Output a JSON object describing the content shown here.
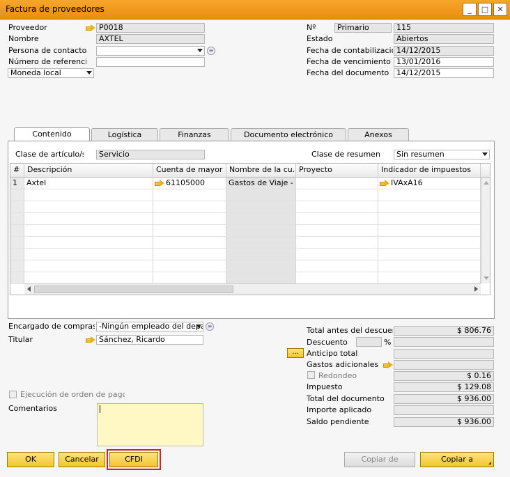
{
  "window": {
    "title": "Factura de proveedores",
    "min": "_",
    "max": "□",
    "close": "✕"
  },
  "header_left": {
    "proveedor_label": "Proveedor",
    "proveedor_value": "P0018",
    "nombre_label": "Nombre",
    "nombre_value": "AXTEL",
    "contacto_label": "Persona de contacto",
    "contacto_value": "",
    "referencia_label": "Número de referencia d",
    "referencia_value": "",
    "moneda_value": "Moneda local"
  },
  "header_right": {
    "no_label": "Nº",
    "serie_value": "Primario",
    "no_value": "115",
    "estado_label": "Estado",
    "estado_value": "Abiertos",
    "fecha_cont_label": "Fecha de contabilización",
    "fecha_cont_value": "14/12/2015",
    "fecha_venc_label": "Fecha de vencimiento",
    "fecha_venc_value": "13/01/2016",
    "fecha_doc_label": "Fecha del documento",
    "fecha_doc_value": "14/12/2015"
  },
  "tabs": [
    "Contenido",
    "Logística",
    "Finanzas",
    "Documento electrónico",
    "Anexos"
  ],
  "content": {
    "clase_articulo_label": "Clase de artículo/ser",
    "clase_articulo_value": "Servicio",
    "clase_resumen_label": "Clase de resumen",
    "clase_resumen_value": "Sin resumen"
  },
  "grid": {
    "headers": [
      "#",
      "Descripción",
      "Cuenta de mayor",
      "Nombre de la cu...",
      "Proyecto",
      "Indicador de impuestos"
    ],
    "rows": [
      {
        "num": "1",
        "descripcion": "Axtel",
        "cuenta": "61105000",
        "nombre": "Gastos de Viaje - Otr",
        "proyecto": "",
        "impuesto": "IVAxA16"
      }
    ]
  },
  "footer_left": {
    "encargado_label": "Encargado de compras",
    "encargado_value": "-Ningún empleado del departa",
    "titular_label": "Titular",
    "titular_value": "Sánchez, Ricardo",
    "ejecucion_label": "Ejecución de orden de pago",
    "comentarios_label": "Comentarios",
    "comentarios_value": ""
  },
  "totals": {
    "total_antes_label": "Total antes del descuento",
    "total_antes_value": "$ 806.76",
    "descuento_label": "Descuento",
    "descuento_pct_symbol": "%",
    "anticipo_btn": "...",
    "anticipo_label": "Anticipo total",
    "gastos_label": "Gastos adicionales",
    "redondeo_label": "Redondeo",
    "redondeo_value": "$ 0.16",
    "impuesto_label": "Impuesto",
    "impuesto_value": "$ 129.08",
    "total_doc_label": "Total del documento",
    "total_doc_value": "$ 936.00",
    "importe_label": "Importe aplicado",
    "importe_value": "",
    "saldo_label": "Saldo pendiente",
    "saldo_value": "$ 936.00"
  },
  "buttons": {
    "ok": "OK",
    "cancel": "Cancelar",
    "cfdi": "CFDI",
    "copy_from": "Copiar de",
    "copy_to": "Copiar a"
  },
  "colors": {
    "title_bar": "#f39c1e",
    "button": "#f6d04a",
    "highlight": "#d42020"
  }
}
